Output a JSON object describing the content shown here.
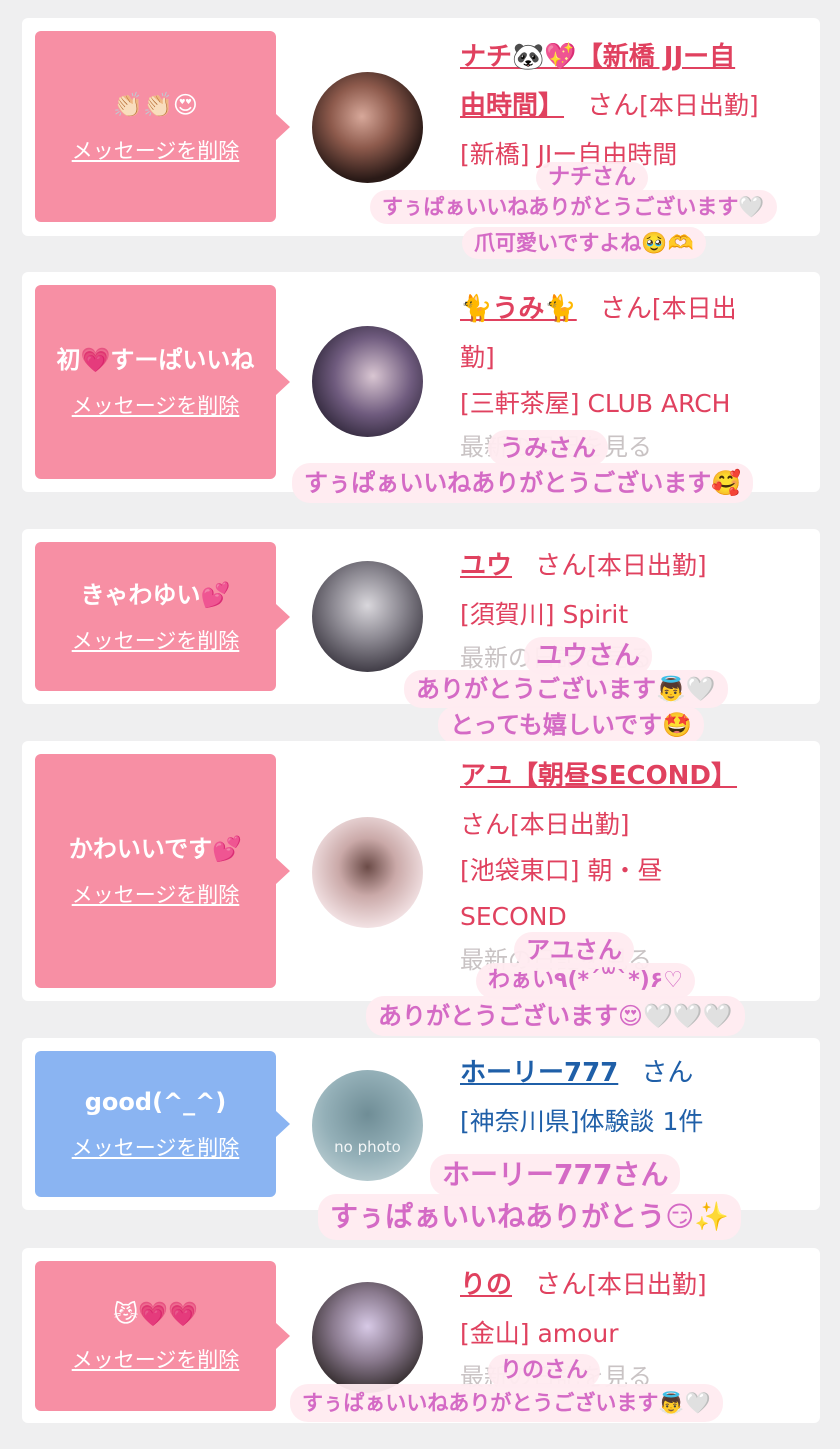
{
  "delete_label": "メッセージを削除",
  "suffix_san": "さん",
  "entries": [
    {
      "message": "👏🏻👏🏻😍",
      "name_a": "ナチ🐼💖【新橋 JJー自",
      "name_b": "由時間】",
      "status": "[本日出勤]",
      "shop": "[新橋] JJー自由時間",
      "reply_name": "ナチさん",
      "reply_1": "すぅぱぁいいねありがとうございます🤍",
      "reply_2": "爪可愛いですよね🥹🫶"
    },
    {
      "message": "初💗すーぱいいね",
      "name": "🐈うみ🐈",
      "status_a": "[本日出",
      "status_b": "勤]",
      "shop": "[三軒茶屋] CLUB ARCH",
      "faded": "最新の日記を見る",
      "reply_name": "うみさん",
      "reply_1": "すぅぱぁいいねありがとうございます🥰"
    },
    {
      "message": "きゃわゆい💕",
      "name": "ユウ",
      "status": "[本日出勤]",
      "shop": "[須賀川] Spirit",
      "faded": "最新の日記を見る",
      "reply_name": "ユウさん",
      "reply_1": "ありがとうございます👼🤍",
      "reply_2": "とっても嬉しいです🤩"
    },
    {
      "message": "かわいいです💕",
      "name": "アユ【朝昼SECOND】",
      "status": "さん[本日出勤]",
      "shop_a": "[池袋東口] 朝・昼",
      "shop_b": "SECOND",
      "faded": "最新の日記を見る",
      "reply_name": "アユさん",
      "reply_1": "わぁい٩(*´꒳`*)۶♡",
      "reply_2": "ありがとうございます😍🤍🤍🤍"
    },
    {
      "message": "good(^_^)",
      "name": "ホーリー777",
      "shop": "[神奈川県]体験談 1件",
      "no_photo": "no photo",
      "reply_name": "ホーリー777さん",
      "reply_1": "すぅぱぁいいねありがとう😏✨"
    },
    {
      "message": "😼💗💗",
      "name": "りの",
      "status": "[本日出勤]",
      "shop": "[金山] amour",
      "faded": "最新の日記を見る",
      "reply_name": "りのさん",
      "reply_1": "すぅぱぁいいねありがとうございます👼🤍"
    }
  ]
}
